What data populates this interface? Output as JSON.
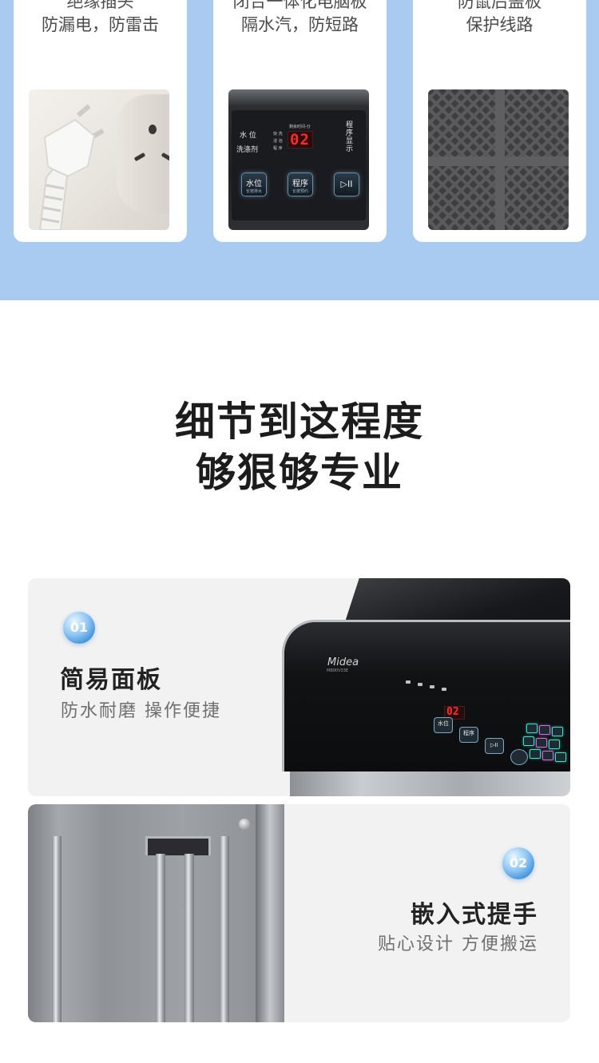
{
  "top_cards": [
    {
      "line1": "绝缘插头",
      "line2": "防漏电，防雷击",
      "image": "plug-socket"
    },
    {
      "line1": "闭合一体化电脑板",
      "line2": "隔水汽，防短路",
      "image": "control-panel"
    },
    {
      "line1": "防鼠后盖板",
      "line2": "保护线路",
      "image": "rear-cover-mesh"
    }
  ],
  "panel_image": {
    "label_water": "水 位",
    "label_detergent": "洗涤剂",
    "label_quick": "快 洗",
    "label_soak": "浸 泡",
    "label_program": "程 序",
    "remaining_time": "剩余时间-分",
    "display": "02",
    "program_display": "程序显示",
    "btn_water": "水位",
    "btn_water_sub": "长按排水",
    "btn_program": "程序",
    "btn_program_sub": "长按预约",
    "btn_start": "▷II"
  },
  "headline": {
    "line1": "细节到这程度",
    "line2": "够狠够专业"
  },
  "features": [
    {
      "badge": "01",
      "title": "简易面板",
      "subtitle": "防水耐磨 操作便捷"
    },
    {
      "badge": "02",
      "title": "嵌入式提手",
      "subtitle": "贴心设计 方便搬运"
    }
  ],
  "washer_image": {
    "brand": "Midea",
    "model": "MB90V33E",
    "display": "02",
    "btn_water": "水位",
    "btn_program": "程序",
    "btn_start": "▷II"
  },
  "colors": {
    "band_blue": "#a9cbf2",
    "badge_blue": "#3a8fdc",
    "digit_red": "#ff2a2a"
  }
}
